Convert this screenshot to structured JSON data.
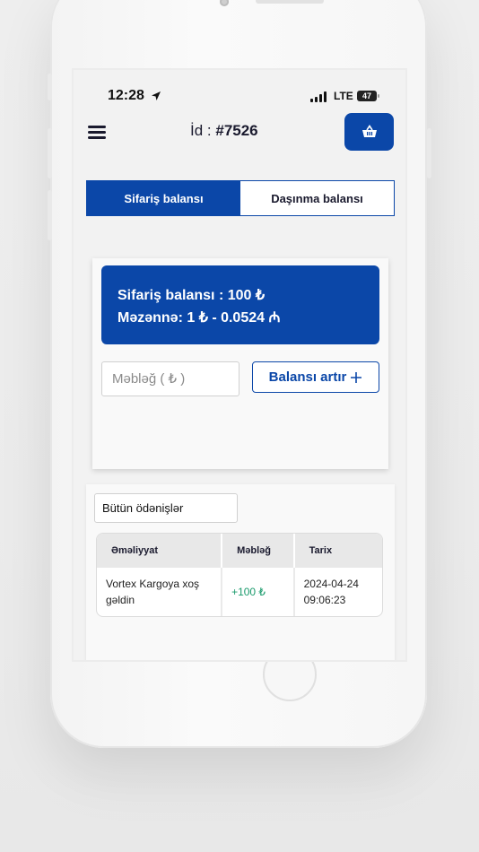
{
  "status_bar": {
    "time": "12:28",
    "network": "LTE",
    "battery": "47"
  },
  "header": {
    "id_label": "İd : ",
    "id_value": "#7526"
  },
  "tabs": [
    {
      "label": "Sifariş balansı",
      "active": true
    },
    {
      "label": "Daşınma balansı",
      "active": false
    }
  ],
  "balance": {
    "order_balance_line": "Sifariş balansı : 100 ₺",
    "rate_line": "Məzənnə: 1 ₺ - 0.0524 ₼"
  },
  "amount_input": {
    "placeholder": "Məbləğ ( ₺ )",
    "value": ""
  },
  "increase_button": {
    "label": "Balansı artır",
    "icon": "plus-icon"
  },
  "filter": {
    "selected": "Bütün ödənişlər"
  },
  "table": {
    "headers": [
      "Əməliyyat",
      "Məbləğ",
      "Tarix"
    ],
    "rows": [
      {
        "operation": "Vortex Kargoya xoş gəldin",
        "amount": "+100 ₺",
        "date": "2024-04-24 09:06:23"
      }
    ]
  },
  "colors": {
    "primary": "#0b47a8",
    "positive": "#1a9a6c"
  }
}
